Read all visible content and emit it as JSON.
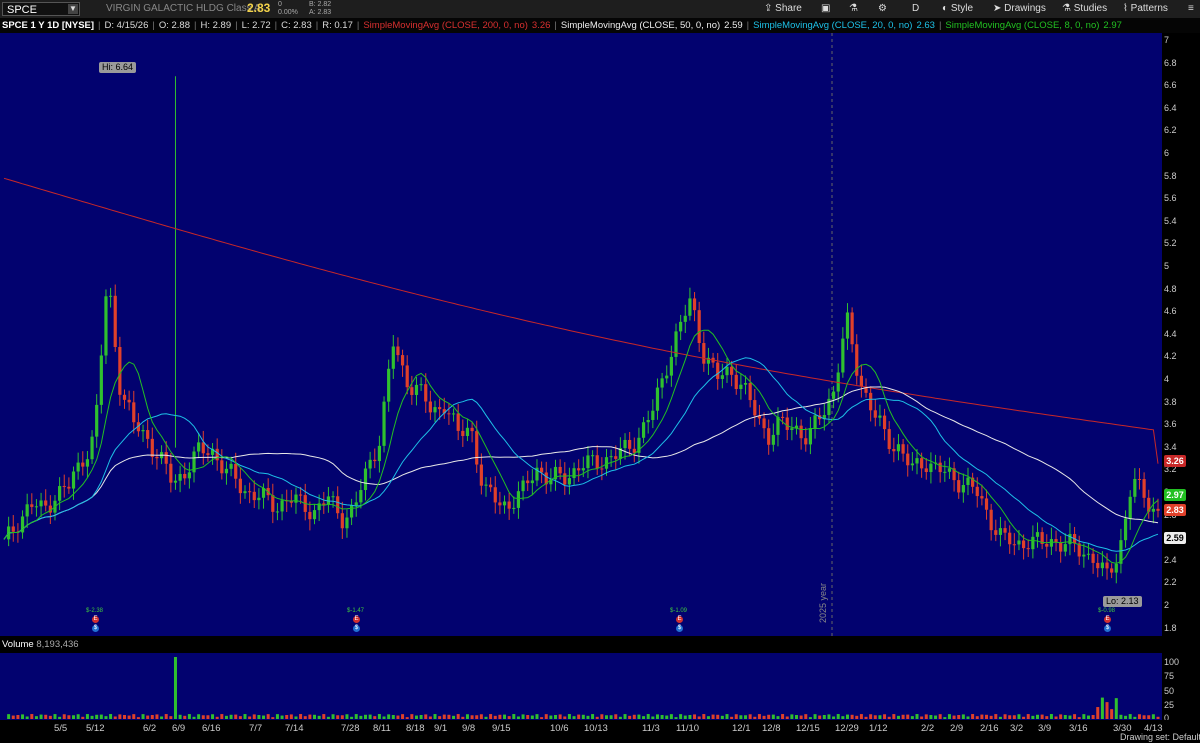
{
  "toolbar": {
    "symbol": "SPCE",
    "company": "VIRGIN GALACTIC HLDG Class A",
    "last": "2.83",
    "change": "0",
    "change_pct": "0.00%",
    "bid": "B: 2.82",
    "ask": "A: 2.83",
    "share": "Share",
    "period": "D",
    "style": "Style",
    "drawings": "Drawings",
    "studies": "Studies",
    "patterns": "Patterns"
  },
  "info": {
    "title": "SPCE 1 Y 1D [NYSE]",
    "date": "D: 4/15/26",
    "open": "O: 2.88",
    "high": "H: 2.89",
    "low": "L: 2.72",
    "close": "C: 2.83",
    "range": "R: 0.17",
    "sma200": "SimpleMovingAvg (CLOSE, 200, 0, no)",
    "sma200_val": "3.26",
    "sma50": "SimpleMovingAvg (CLOSE, 50, 0, no)",
    "sma50_val": "2.59",
    "sma20": "SimpleMovingAvg (CLOSE, 20, 0, no)",
    "sma20_val": "2.63",
    "sma8": "SimpleMovingAvg (CLOSE, 8, 0, no)",
    "sma8_val": "2.97"
  },
  "labels": {
    "hi": "Hi: 6.64",
    "lo": "Lo: 2.13",
    "year": "2025 year",
    "earn1": "$-2.38",
    "earn2": "$-1.47",
    "earn3": "$-1.09",
    "earn4": "$-0.98"
  },
  "volume": {
    "label": "Volume",
    "value": "8,193,436",
    "ticks": [
      "100",
      "75",
      "50",
      "25",
      "0"
    ]
  },
  "price_ticks": [
    "7",
    "6.8",
    "6.6",
    "6.4",
    "6.2",
    "6",
    "5.8",
    "5.6",
    "5.4",
    "5.2",
    "5",
    "4.8",
    "4.6",
    "4.4",
    "4.2",
    "4",
    "3.8",
    "3.6",
    "3.4",
    "3.2",
    "3",
    "2.8",
    "2.6",
    "2.4",
    "2.2",
    "2",
    "1.8"
  ],
  "badges": {
    "sma200": "3.26",
    "sma8": "2.97",
    "last": "2.83",
    "sma50": "2.59"
  },
  "date_ticks": [
    "5/5",
    "5/12",
    "6/2",
    "6/9",
    "6/16",
    "7/7",
    "7/14",
    "7/28",
    "8/11",
    "8/18",
    "9/1",
    "9/8",
    "9/15",
    "10/6",
    "10/13",
    "11/3",
    "11/10",
    "12/1",
    "12/8",
    "12/15",
    "12/29",
    "1/12",
    "2/2",
    "2/9",
    "2/16",
    "3/2",
    "3/9",
    "3/16",
    "3/30",
    "4/13"
  ],
  "footer": "Drawing set: Default",
  "colors": {
    "bg": "#02026f",
    "up": "#2fc02f",
    "down": "#e0402a",
    "sma200": "#c82828",
    "sma50": "#e8e8e8",
    "sma20": "#1ec0e6",
    "sma8": "#22c022"
  },
  "chart_data": {
    "type": "candlestick",
    "symbol": "SPCE",
    "period": "1Y 1D",
    "ylim": [
      1.8,
      7.0
    ],
    "high": 6.64,
    "low": 2.13,
    "last": 2.83,
    "sma": {
      "200": 3.26,
      "50": 2.59,
      "20": 2.63,
      "8": 2.97
    },
    "close_path": [
      2.55,
      2.75,
      2.9,
      2.85,
      3.0,
      3.05,
      3.3,
      3.5,
      4.9,
      3.9,
      3.6,
      3.5,
      3.3,
      3.1,
      3.2,
      3.35,
      3.4,
      3.2,
      3.1,
      3.0,
      2.95,
      2.9,
      2.95,
      2.9,
      2.85,
      2.95,
      2.8,
      2.85,
      3.2,
      3.5,
      4.3,
      4.0,
      3.9,
      3.7,
      3.8,
      3.5,
      3.6,
      3.0,
      2.95,
      2.9,
      3.0,
      3.25,
      3.1,
      3.15,
      3.2,
      3.25,
      3.3,
      3.3,
      3.4,
      3.5,
      3.7,
      4.1,
      4.4,
      4.7,
      4.2,
      4.0,
      4.1,
      3.9,
      3.7,
      3.5,
      3.6,
      3.6,
      3.45,
      3.7,
      3.9,
      4.5,
      4.0,
      3.7,
      3.5,
      3.4,
      3.2,
      3.3,
      3.2,
      3.15,
      3.1,
      3.0,
      2.8,
      2.6,
      2.55,
      2.6,
      2.55,
      2.6,
      2.55,
      2.5,
      2.45,
      2.25,
      2.5,
      3.1,
      2.97,
      2.83
    ]
  }
}
